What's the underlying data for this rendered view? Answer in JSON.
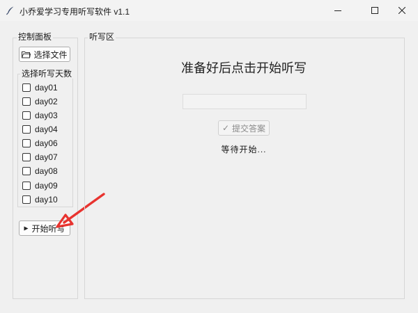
{
  "window": {
    "title": "小乔爱学习专用听写软件 v1.1"
  },
  "control_panel": {
    "label": "控制面板",
    "select_file_label": "选择文件",
    "days_group_label": "选择听写天数",
    "days": [
      {
        "label": "day01",
        "checked": false
      },
      {
        "label": "day02",
        "checked": false
      },
      {
        "label": "day03",
        "checked": false
      },
      {
        "label": "day04",
        "checked": false
      },
      {
        "label": "day06",
        "checked": false
      },
      {
        "label": "day07",
        "checked": false
      },
      {
        "label": "day08",
        "checked": false
      },
      {
        "label": "day09",
        "checked": false
      },
      {
        "label": "day10",
        "checked": false
      }
    ],
    "start_label": "开始听写"
  },
  "dictation": {
    "label": "听写区",
    "prompt": "准备好后点击开始听写",
    "answer_value": "",
    "submit_label": "提交答案",
    "status": "等待开始..."
  },
  "colors": {
    "annotation_arrow": "#e8332f"
  }
}
